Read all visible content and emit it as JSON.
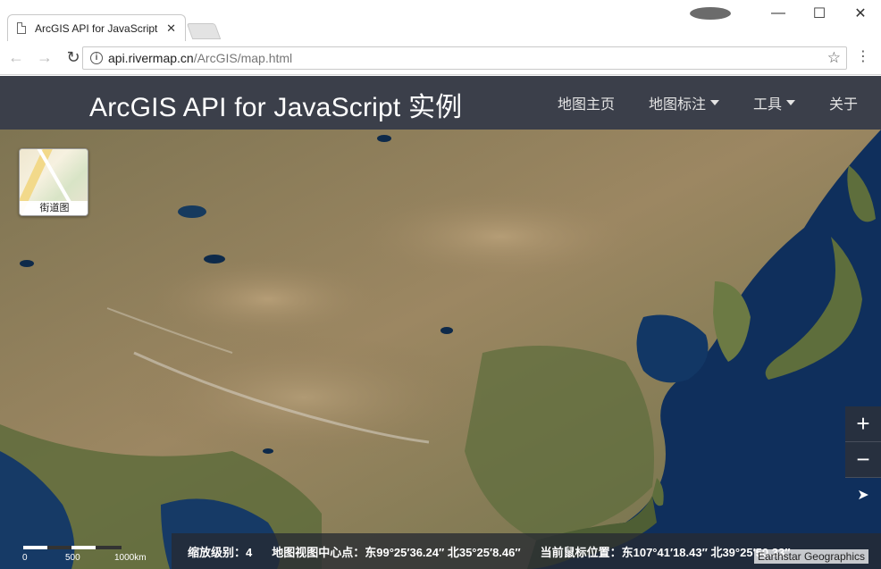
{
  "browser": {
    "tab_title": "ArcGIS API for JavaScript",
    "tab_close": "✕",
    "url_host": "api.rivermap.cn",
    "url_path": "/ArcGIS/map.html",
    "window_controls": {
      "minimize": "—",
      "maximize": "☐",
      "close": "✕"
    },
    "nav": {
      "back": "←",
      "forward": "→",
      "reload": "↻"
    },
    "info_symbol": "i",
    "star_symbol": "☆",
    "menu_symbol": "⋮"
  },
  "navbar": {
    "brand": "ArcGIS API for JavaScript 实例",
    "items": [
      {
        "label": "地图主页",
        "has_dropdown": false
      },
      {
        "label": "地图标注",
        "has_dropdown": true
      },
      {
        "label": "工具",
        "has_dropdown": true
      },
      {
        "label": "关于",
        "has_dropdown": false
      }
    ]
  },
  "map": {
    "basemap_toggle_label": "街道图",
    "zoom_in": "+",
    "zoom_out": "−",
    "locate": "➤",
    "scale_labels": [
      "0",
      "500",
      "1000km"
    ],
    "status": {
      "zoom_level": "缩放级别：4",
      "center": "地图视图中心点：东99°25′36.24″  北35°25′8.46″",
      "cursor": "当前鼠标位置：东107°41′18.43″  北39°25′50.33″"
    },
    "attribution": "Earthstar Geographics"
  },
  "colors": {
    "navbar_bg": "#3b3f4a",
    "land": "#8b7a58",
    "ocean": "#0f2f5c",
    "highlands": "#a89068"
  }
}
